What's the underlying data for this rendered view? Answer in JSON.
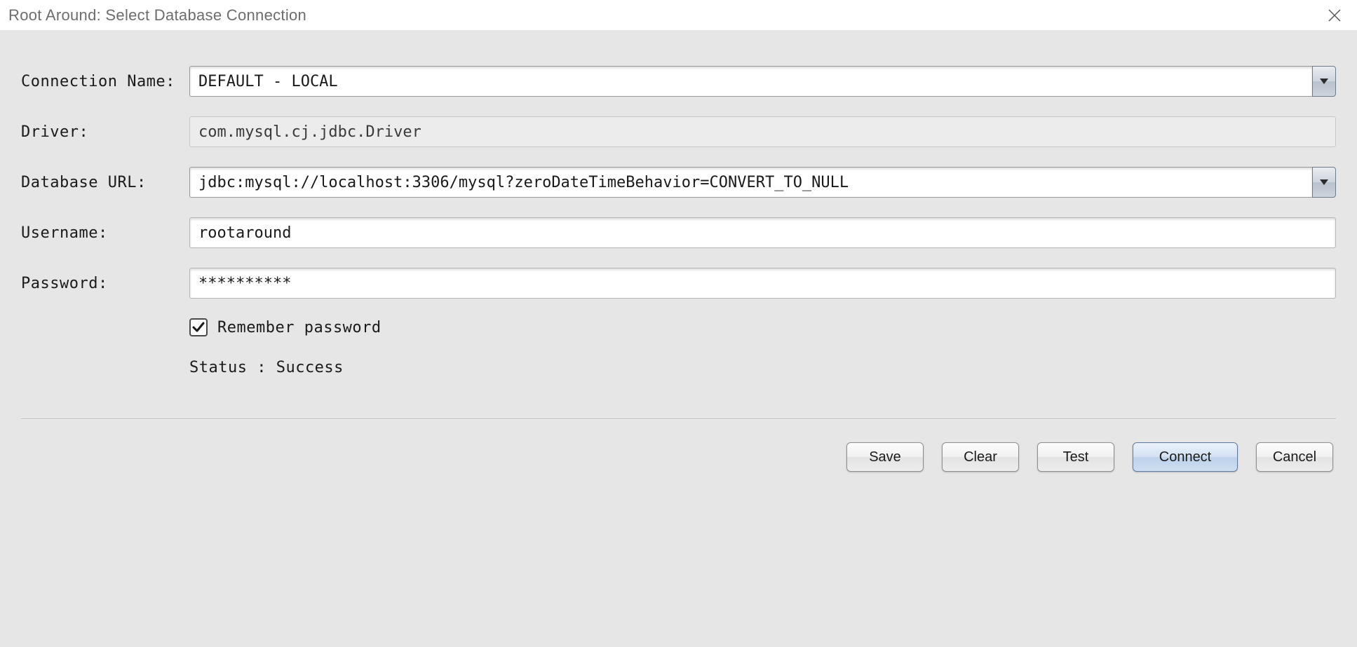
{
  "window": {
    "title": "Root Around: Select Database Connection"
  },
  "form": {
    "connection_name": {
      "label": "Connection Name:",
      "value": "DEFAULT - LOCAL"
    },
    "driver": {
      "label": "Driver:",
      "value": "com.mysql.cj.jdbc.Driver"
    },
    "database_url": {
      "label": "Database URL:",
      "value": "jdbc:mysql://localhost:3306/mysql?zeroDateTimeBehavior=CONVERT_TO_NULL"
    },
    "username": {
      "label": "Username:",
      "value": "rootaround"
    },
    "password": {
      "label": "Password:",
      "value": "**********"
    },
    "remember": {
      "label": "Remember password",
      "checked": true
    },
    "status": {
      "text": "Status : Success"
    }
  },
  "buttons": {
    "save": "Save",
    "clear": "Clear",
    "test": "Test",
    "connect": "Connect",
    "cancel": "Cancel"
  }
}
